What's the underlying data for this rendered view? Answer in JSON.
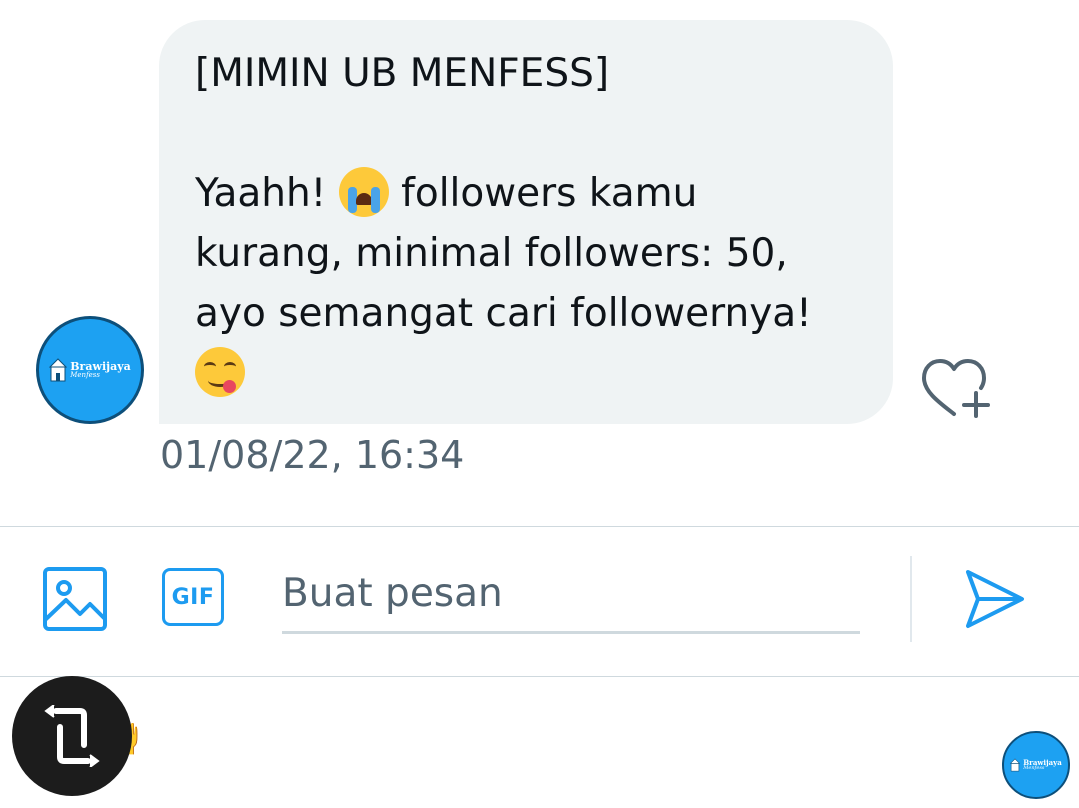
{
  "conversation": {
    "sender_avatar": {
      "brand_text": "Brawijaya",
      "brand_sub": "Menfess",
      "bg_color": "#1da1f2"
    },
    "message": {
      "lines": [
        "[MIMIN UB MENFESS]",
        "",
        "Yaahh! ",
        " followers kamu",
        "kurang, minimal followers: 50,",
        "ayo semangat cari followernya!"
      ],
      "emojis": [
        "loudly-crying-face",
        "face-savoring-food"
      ],
      "timestamp": "01/08/22, 16:34"
    },
    "react_icon": "heart-plus-icon"
  },
  "composer": {
    "image_icon": "image-icon",
    "gif_label": "GIF",
    "placeholder": "Buat pesan",
    "send_icon": "send-icon",
    "accent_color": "#1d9bf0"
  },
  "bottom_bar": {
    "rotate_icon": "rotate-icon",
    "hands_emoji": "🙌",
    "self_avatar": {
      "brand_text": "Brawijaya",
      "brand_sub": "Menfess"
    }
  }
}
